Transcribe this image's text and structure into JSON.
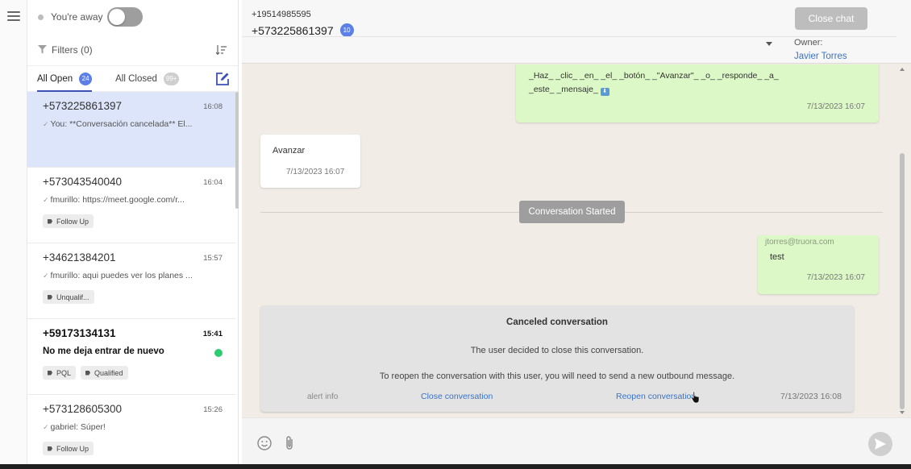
{
  "sidebar": {
    "away_label": "You're away",
    "filters_label": "Filters (0)",
    "tabs": [
      {
        "label": "All Open",
        "badge": "24"
      },
      {
        "label": "All Closed",
        "badge": "99+"
      }
    ],
    "conversations": [
      {
        "phone": "+573225861397",
        "time": "16:08",
        "preview": "You: **Conversación cancelada** El...",
        "tags": []
      },
      {
        "phone": "+573043540040",
        "time": "16:04",
        "preview": "fmurillo: https://meet.google.com/r...",
        "tags": [
          "Follow Up"
        ]
      },
      {
        "phone": "+34621384201",
        "time": "15:57",
        "preview": "fmurillo: aqui puedes ver los planes ...",
        "tags": [
          "Unqualif..."
        ]
      },
      {
        "phone": "+59173134131",
        "time": "15:41",
        "preview": "No me deja entrar de nuevo",
        "tags": [
          "PQL",
          "Qualified"
        ]
      },
      {
        "phone": "+573128605300",
        "time": "15:26",
        "preview": "gabriel: Súper!",
        "tags": [
          "Follow Up"
        ]
      }
    ]
  },
  "chat": {
    "header": {
      "phone_small": "+19514985595",
      "phone": "+573225861397",
      "badge": "10",
      "close_label": "Close chat",
      "owner_label": "Owner:",
      "owner_name": "Javier Torres"
    },
    "messages": {
      "m1": {
        "line1": "_Haz_ _clic_ _en_ _el_ _botón_ _\"Avanzar\"_ _o_ _responde_ _a_",
        "line2": "_este_ _mensaje_",
        "time": "7/13/2023 16:07"
      },
      "m2": {
        "text": "Avanzar",
        "time": "7/13/2023 16:07"
      },
      "system": "Conversation Started",
      "m3": {
        "sender": "jtorres@truora.com",
        "text": "test",
        "time": "7/13/2023 16:07"
      }
    },
    "canceled": {
      "title": "Canceled conversation",
      "line1": "The user decided to close this conversation.",
      "line2": "To reopen the conversation with this user, you will need to send a new outbound message.",
      "alert": "alert info",
      "close_link": "Close conversation",
      "reopen_link": "Reopen conversation",
      "time": "7/13/2023 16:08"
    },
    "composer": {
      "placeholder": ""
    }
  },
  "colors": {
    "accent": "#5c7fe8",
    "outgoing": "#dcf8c6",
    "chat_bg": "#f1ede6",
    "link": "#3b73c4"
  }
}
